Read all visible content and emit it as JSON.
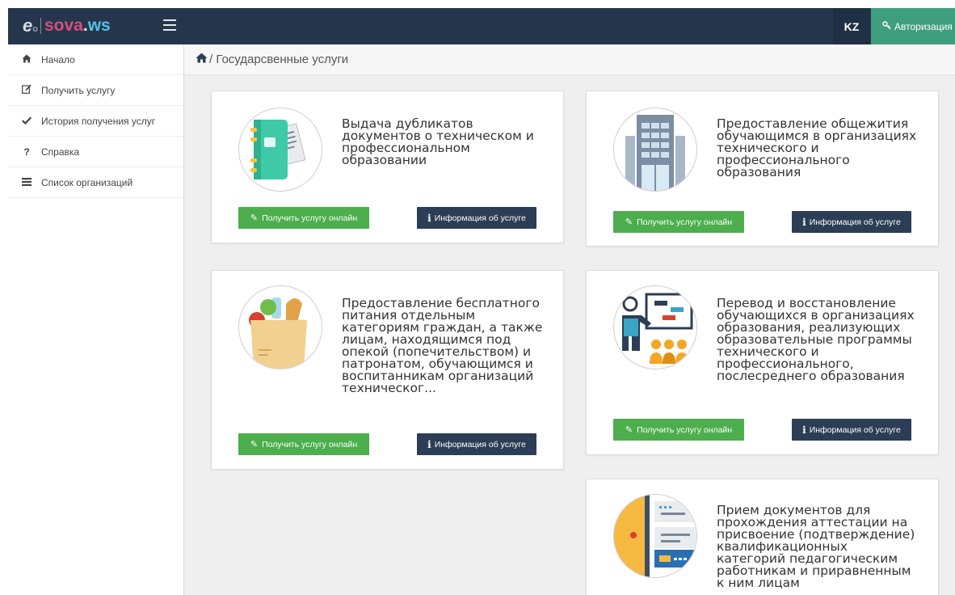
{
  "header": {
    "logo_e": "e",
    "logo_small": "o",
    "logo_sova": "sova",
    "logo_dot": ".",
    "logo_ws": "ws",
    "lang": "KZ",
    "auth_icon": "🔍",
    "auth_label": "Авторизация"
  },
  "sidebar": {
    "items": [
      {
        "icon": "home-icon",
        "glyph": "🏠",
        "label": "Начало"
      },
      {
        "icon": "edit-icon",
        "glyph": "✎",
        "label": "Получить услугу"
      },
      {
        "icon": "check-icon",
        "glyph": "✔",
        "label": "История получения услуг"
      },
      {
        "icon": "question-icon",
        "glyph": "?",
        "label": "Справка"
      },
      {
        "icon": "list-icon",
        "glyph": "☰",
        "label": "Список организаций"
      }
    ]
  },
  "breadcrumb": {
    "home_glyph": "🏠",
    "text": "/ Государсвенные услуги"
  },
  "buttons": {
    "get_label": "Получить услугу онлайн",
    "info_label": "Информация об услуге",
    "get_glyph": "✎",
    "info_glyph": "i"
  },
  "cards": [
    {
      "icon": "notebook-icon",
      "title": "Выдача дубликатов документов о техническом и профессиональном образовании"
    },
    {
      "icon": "building-icon",
      "title": "Предоставление общежития обучающимся в организациях технического и профессионального образования"
    },
    {
      "icon": "grocery-bag-icon",
      "title": "Предоставление бесплатного питания отдельным категориям граждан, а также лицам, находящимся под опекой (попечительством) и патронатом, обучающимся и воспитанникам организаций техническог..."
    },
    {
      "icon": "presentation-icon",
      "title": "Перевод и восстановление обучающихся в организациях образования, реализующих образовательные программы технического и профессионального, послесреднего образования"
    },
    {
      "icon": "code-window-icon",
      "title": "Прием документов для прохождения аттестации на присвоение (подтверждение) квалификационных категорий педагогическим работникам и приравненным к ним лицам"
    }
  ],
  "colors": {
    "topbar": "#25364c",
    "auth": "#3f9e7e",
    "green_button": "#4cae4c",
    "dark_button": "#2c3e55"
  }
}
